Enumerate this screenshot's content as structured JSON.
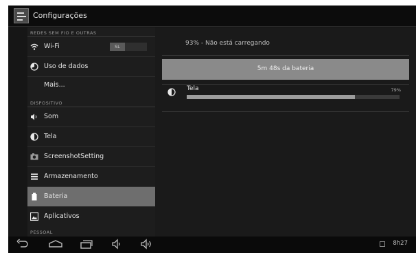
{
  "header": {
    "title": "Configurações"
  },
  "sidebar": {
    "categories": [
      "REDES SEM FIO E OUTRAS",
      "DISPOSITIVO",
      "PESSOAL"
    ],
    "items": [
      {
        "label": "Wi-Fi",
        "icon": "wifi-icon",
        "toggle": "SL"
      },
      {
        "label": "Uso de dados",
        "icon": "data-usage-icon"
      },
      {
        "label": "Mais..."
      },
      {
        "label": "Som",
        "icon": "speaker-icon"
      },
      {
        "label": "Tela",
        "icon": "brightness-icon"
      },
      {
        "label": "ScreenshotSetting",
        "icon": "camera-icon"
      },
      {
        "label": "Armazenamento",
        "icon": "storage-icon"
      },
      {
        "label": "Bateria",
        "icon": "battery-icon",
        "selected": true
      },
      {
        "label": "Aplicativos",
        "icon": "apps-icon"
      }
    ]
  },
  "main": {
    "status": "93% - Não está carregando",
    "graph_label": "5m 48s da bateria",
    "usage": [
      {
        "label": "Tela",
        "percent_text": "79%",
        "percent": 79,
        "icon": "brightness-icon"
      }
    ]
  },
  "statusbar": {
    "time": "8h27"
  }
}
